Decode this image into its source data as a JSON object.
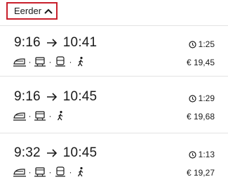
{
  "earlier": {
    "label": "Eerder"
  },
  "trips": [
    {
      "departure": "9:16",
      "arrival": "10:41",
      "duration": "1:25",
      "price": "€ 19,45",
      "modes": [
        "high-speed-train",
        "intercity-train",
        "bus",
        "walk"
      ]
    },
    {
      "departure": "9:16",
      "arrival": "10:45",
      "duration": "1:29",
      "price": "€ 19,68",
      "modes": [
        "high-speed-train",
        "intercity-train",
        "walk"
      ]
    },
    {
      "departure": "9:32",
      "arrival": "10:45",
      "duration": "1:13",
      "price": "€ 19,27",
      "modes": [
        "high-speed-train",
        "intercity-train",
        "bus",
        "walk"
      ]
    }
  ],
  "separator": "·"
}
